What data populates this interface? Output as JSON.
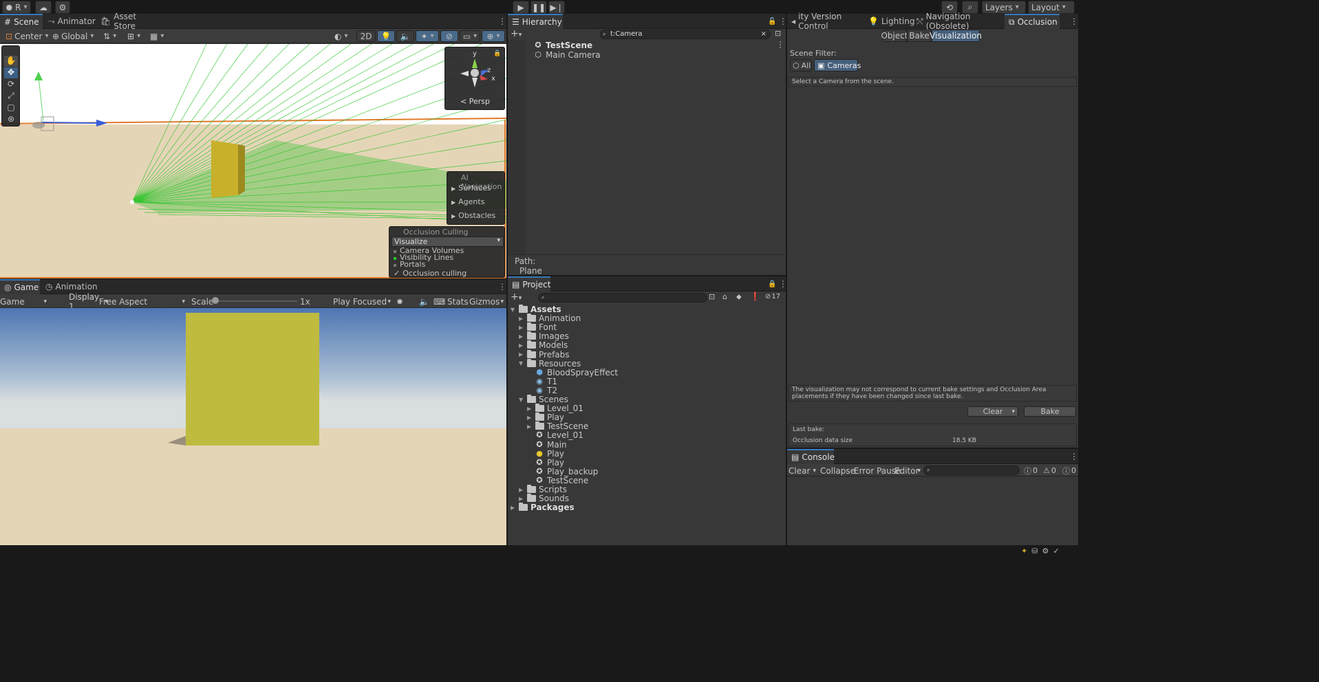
{
  "topbar": {
    "account": "R",
    "layers": "Layers",
    "layout": "Layout"
  },
  "scene": {
    "tabs": [
      "Scene",
      "Animator",
      "Asset Store"
    ],
    "pivot": "Center",
    "space": "Global",
    "mode2d": "2D",
    "persp": "Persp",
    "gizmo_axes": {
      "y": "y",
      "z": "z",
      "x": "x"
    },
    "ai_nav": {
      "title": "AI Navigation",
      "items": [
        "Surfaces",
        "Agents",
        "Obstacles"
      ]
    },
    "occlusion": {
      "title": "Occlusion Culling",
      "mode": "Visualize",
      "items": [
        "Camera Volumes",
        "Visibility Lines",
        "Portals"
      ],
      "checkbox": "Occlusion culling"
    }
  },
  "game": {
    "tabs": [
      "Game",
      "Animation"
    ],
    "display_mode": "Game",
    "display": "Display 1",
    "aspect": "Free Aspect",
    "scale_label": "Scale",
    "scale_value": "1x",
    "play_mode": "Play Focused",
    "stats": "Stats",
    "gizmos": "Gizmos"
  },
  "hierarchy": {
    "title": "Hierarchy",
    "search": "t:Camera",
    "items": [
      "TestScene",
      "Main Camera"
    ],
    "path_label": "Path:",
    "path_value": "Plane"
  },
  "project": {
    "title": "Project",
    "hidden_count": "17",
    "tree": [
      {
        "label": "Assets",
        "depth": 0,
        "kind": "folder",
        "bold": true,
        "open": true
      },
      {
        "label": "Animation",
        "depth": 1,
        "kind": "folder"
      },
      {
        "label": "Font",
        "depth": 1,
        "kind": "folder"
      },
      {
        "label": "Images",
        "depth": 1,
        "kind": "folder"
      },
      {
        "label": "Models",
        "depth": 1,
        "kind": "folder"
      },
      {
        "label": "Prefabs",
        "depth": 1,
        "kind": "folder"
      },
      {
        "label": "Resources",
        "depth": 1,
        "kind": "folder",
        "open": true
      },
      {
        "label": "BloodSprayEffect",
        "depth": 2,
        "kind": "prefab"
      },
      {
        "label": "T1",
        "depth": 2,
        "kind": "material"
      },
      {
        "label": "T2",
        "depth": 2,
        "kind": "material"
      },
      {
        "label": "Scenes",
        "depth": 1,
        "kind": "folder",
        "open": true
      },
      {
        "label": "Level_01",
        "depth": 2,
        "kind": "folder"
      },
      {
        "label": "Play",
        "depth": 2,
        "kind": "folder"
      },
      {
        "label": "TestScene",
        "depth": 2,
        "kind": "folder"
      },
      {
        "label": "Level_01",
        "depth": 2,
        "kind": "scene"
      },
      {
        "label": "Main",
        "depth": 2,
        "kind": "scene"
      },
      {
        "label": "Play",
        "depth": 2,
        "kind": "lightscene"
      },
      {
        "label": "Play",
        "depth": 2,
        "kind": "scene"
      },
      {
        "label": "Play_backup",
        "depth": 2,
        "kind": "scene"
      },
      {
        "label": "TestScene",
        "depth": 2,
        "kind": "scene"
      },
      {
        "label": "Scripts",
        "depth": 1,
        "kind": "folder"
      },
      {
        "label": "Sounds",
        "depth": 1,
        "kind": "folder"
      },
      {
        "label": "Packages",
        "depth": 0,
        "kind": "folder",
        "bold": true
      }
    ]
  },
  "occlusion_window": {
    "tabs": [
      "ity Version Control",
      "Lighting",
      "Navigation (Obsolete)",
      "Occlusion"
    ],
    "modes": [
      "Object",
      "Bake",
      "Visualization"
    ],
    "scene_filter_label": "Scene Filter:",
    "filter_all": "All",
    "filter_cameras": "Cameras",
    "hint": "Select a Camera from the scene.",
    "warning": "The visualization may not correspond to current bake settings and Occlusion Area placements if they have been changed since last bake.",
    "clear": "Clear",
    "bake": "Bake",
    "last_bake_label": "Last bake:",
    "data_size_label": "Occlusion data size",
    "data_size_value": "18.5 KB"
  },
  "console": {
    "title": "Console",
    "clear": "Clear",
    "collapse": "Collapse",
    "error_pause": "Error Pause",
    "editor": "Editor",
    "info_count": "0",
    "warn_count": "0",
    "error_count": "0"
  }
}
